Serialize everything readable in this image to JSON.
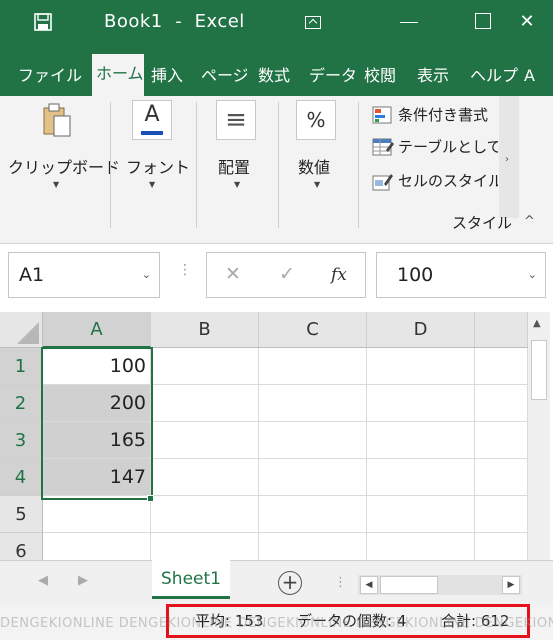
{
  "titlebar": {
    "title": "Book1  -  Excel",
    "save_icon": "save-icon",
    "ribbon_display_icon": "ribbon-display-icon",
    "minimize_icon": "minimize-icon",
    "restore_icon": "restore-icon",
    "close_glyph": "✕",
    "close_icon": "close-icon"
  },
  "tabs": [
    {
      "label": "ファイル"
    },
    {
      "label": "ホーム",
      "active": true
    },
    {
      "label": "挿入"
    },
    {
      "label": "ページ"
    },
    {
      "label": "数式"
    },
    {
      "label": "データ"
    },
    {
      "label": "校閲"
    },
    {
      "label": "表示"
    },
    {
      "label": "ヘルプ"
    },
    {
      "label": "A"
    }
  ],
  "ribbon": {
    "clipboard": {
      "label": "クリップボード",
      "icon": "paste-icon"
    },
    "font": {
      "label": "フォント",
      "icon": "font-color-icon",
      "glyph": "A"
    },
    "alignment": {
      "label": "配置",
      "icon": "align-icon",
      "glyph": "≡"
    },
    "number": {
      "label": "数値",
      "icon": "percent-icon",
      "glyph": "%"
    },
    "styles": {
      "items": [
        {
          "label": "条件付き書式",
          "icon": "conditional-format-icon"
        },
        {
          "label": "テーブルとして",
          "icon": "format-as-table-icon"
        },
        {
          "label": "セルのスタイル",
          "icon": "cell-styles-icon"
        }
      ],
      "caption": "スタイル"
    },
    "more_glyph": "›",
    "collapse_glyph": "^"
  },
  "formula_bar": {
    "name_box": "A1",
    "cancel_glyph": "✕",
    "enter_glyph": "✓",
    "fx_glyph": "fx",
    "value": "100",
    "dropdown_glyph": "⌄"
  },
  "grid": {
    "columns": [
      "A",
      "B",
      "C",
      "D"
    ],
    "rows": [
      "1",
      "2",
      "3",
      "4",
      "5",
      "6"
    ],
    "values": [
      "100",
      "200",
      "165",
      "147"
    ]
  },
  "sheets": {
    "prev_glyph": "◀",
    "next_glyph": "▶",
    "active_tab": "Sheet1",
    "add_glyph": "+",
    "dots": "⋮",
    "scroll_left": "◀",
    "scroll_right": "▶"
  },
  "status": {
    "average_label": "平均: 153",
    "count_label": "データの個数: 4",
    "sum_label": "合計: 612"
  },
  "watermark": "DENGEKIONLINE DENGEKIONLINE DENGEKIONLINE DENGEKIONLINE DENGEKIONLINE",
  "colors": {
    "accent": "#217346",
    "highlight_box": "#e5121b"
  }
}
